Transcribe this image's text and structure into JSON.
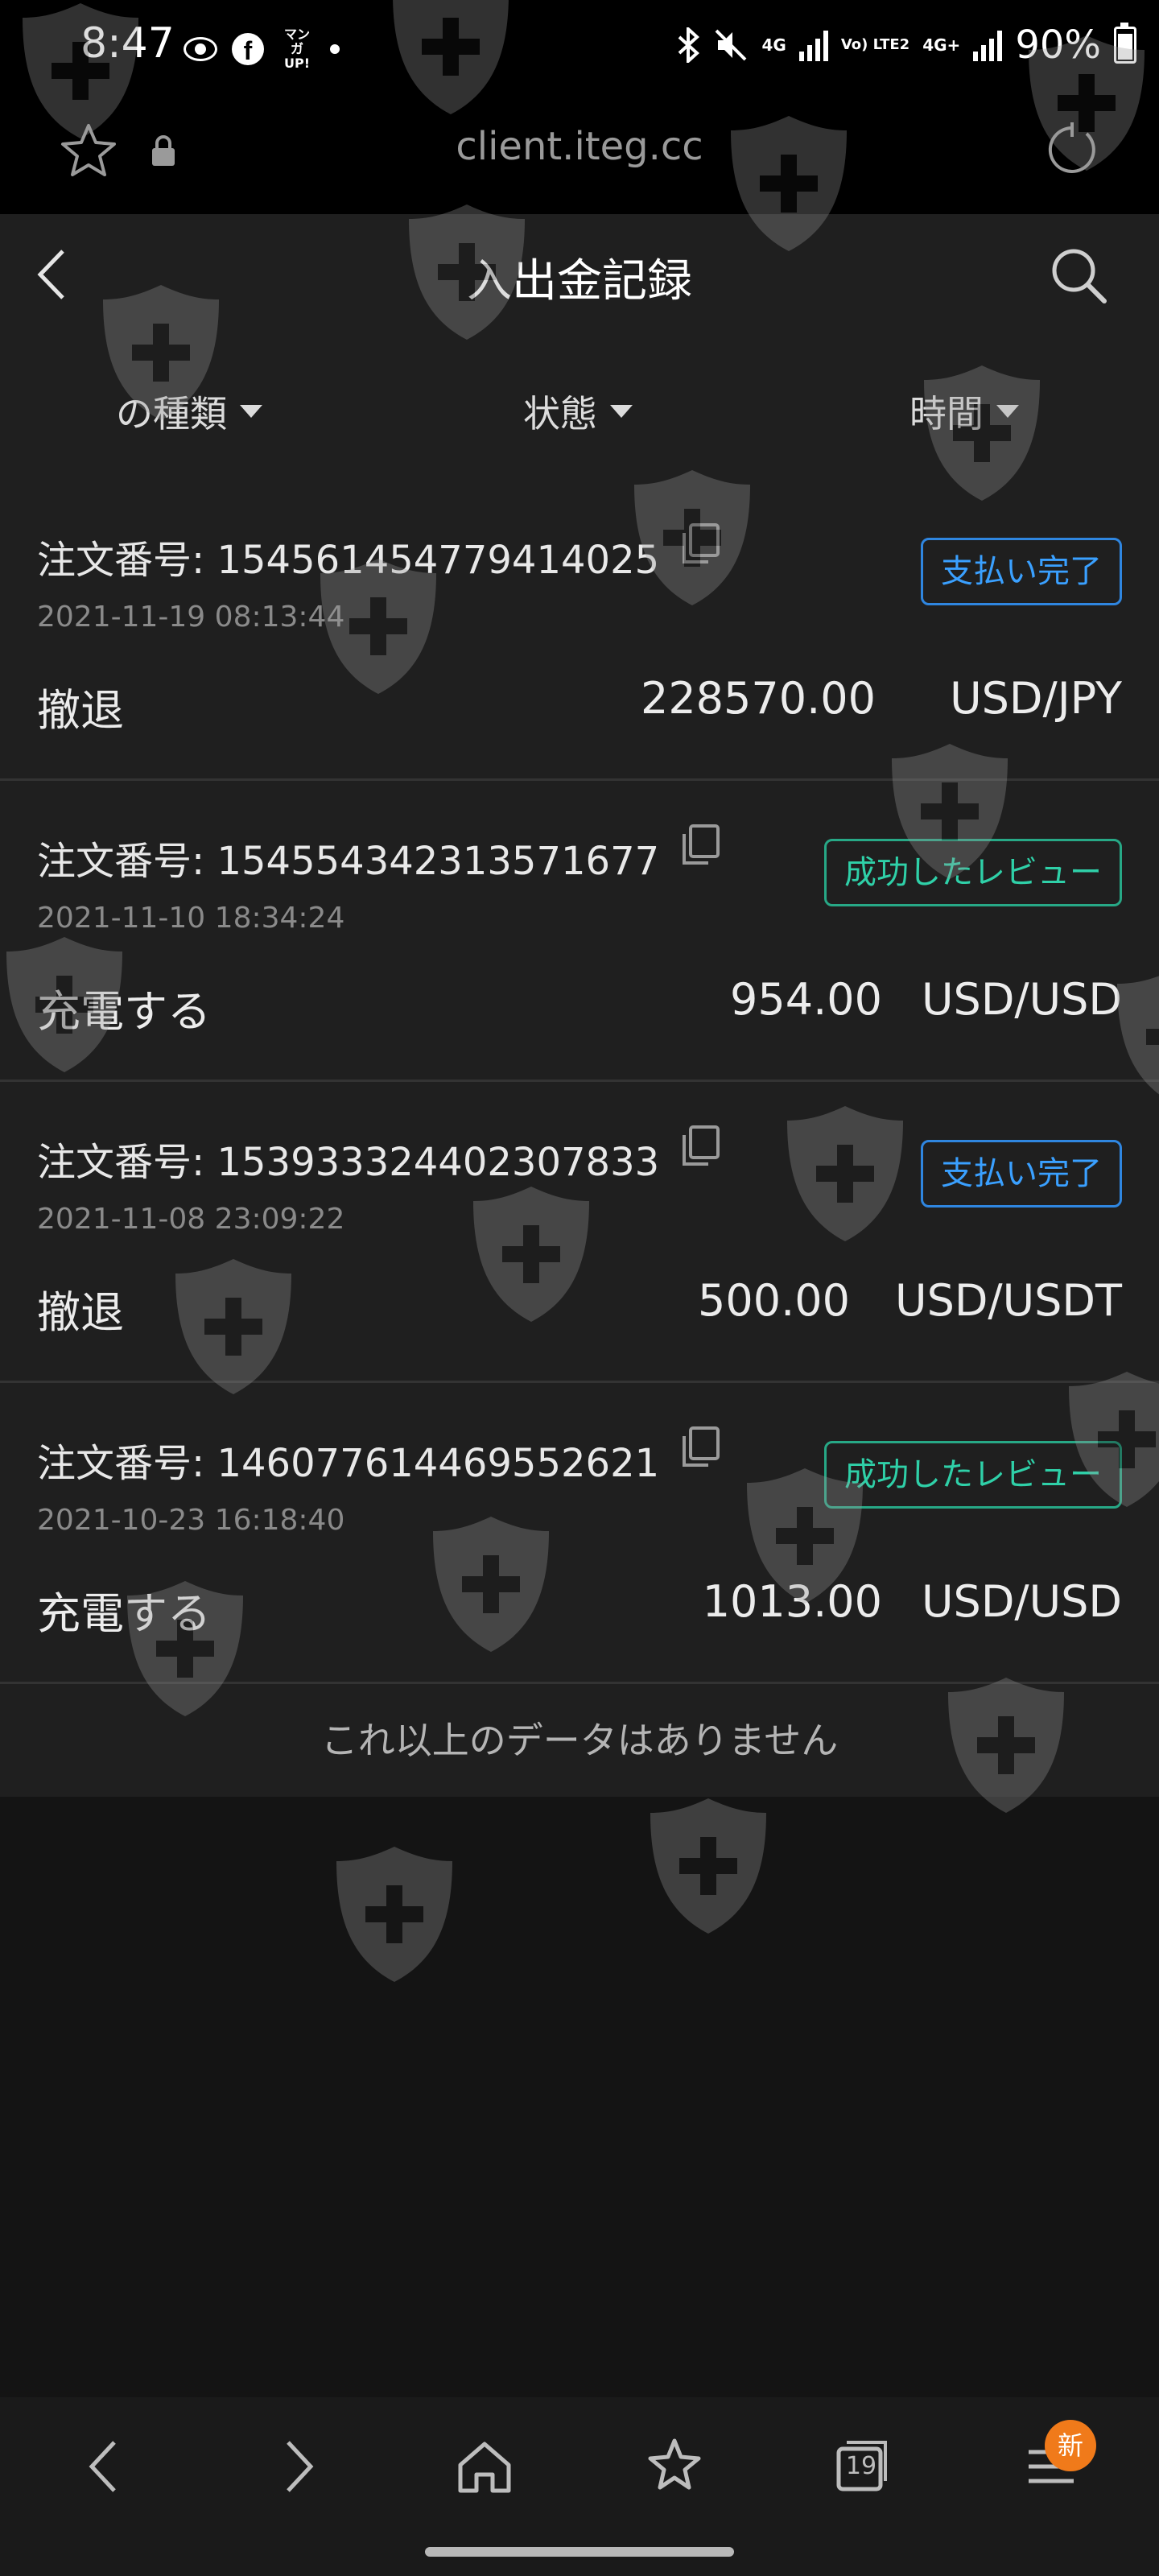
{
  "status_bar": {
    "time": "8:47",
    "manga_label": "マンガ UP!",
    "network_4g": "4G",
    "volte": "Vo) LTE2",
    "network_4g_plus": "4G+",
    "battery": "90%"
  },
  "browser": {
    "url": "client.iteg.cc",
    "tab_count": "19",
    "menu_badge": "新"
  },
  "header": {
    "title": "入出金記録"
  },
  "filters": [
    {
      "label": "の種類"
    },
    {
      "label": "状態"
    },
    {
      "label": "時間"
    }
  ],
  "order_prefix": "注文番号:",
  "records": [
    {
      "order_no": "154561454779414025",
      "datetime": "2021-11-19 08:13:44",
      "status": "支払い完了",
      "type": "撤退",
      "amount": "228570.00",
      "currency": "USD/JPY"
    },
    {
      "order_no": "154554342313571677",
      "datetime": "2021-11-10 18:34:24",
      "status": "成功したレビュー",
      "type": "充電する",
      "amount": "954.00",
      "currency": "USD/USD"
    },
    {
      "order_no": "153933324402307833",
      "datetime": "2021-11-08 23:09:22",
      "status": "支払い完了",
      "type": "撤退",
      "amount": "500.00",
      "currency": "USD/USDT"
    },
    {
      "order_no": "146077614469552621",
      "datetime": "2021-10-23 16:18:40",
      "status": "成功したレビュー",
      "type": "充電する",
      "amount": "1013.00",
      "currency": "USD/USD"
    }
  ],
  "footer_message": "これ以上のデータはありません",
  "colors": {
    "paid_status": "#3aa0ff",
    "success_status": "#2fd0a8",
    "new_badge": "#f07a1a"
  }
}
